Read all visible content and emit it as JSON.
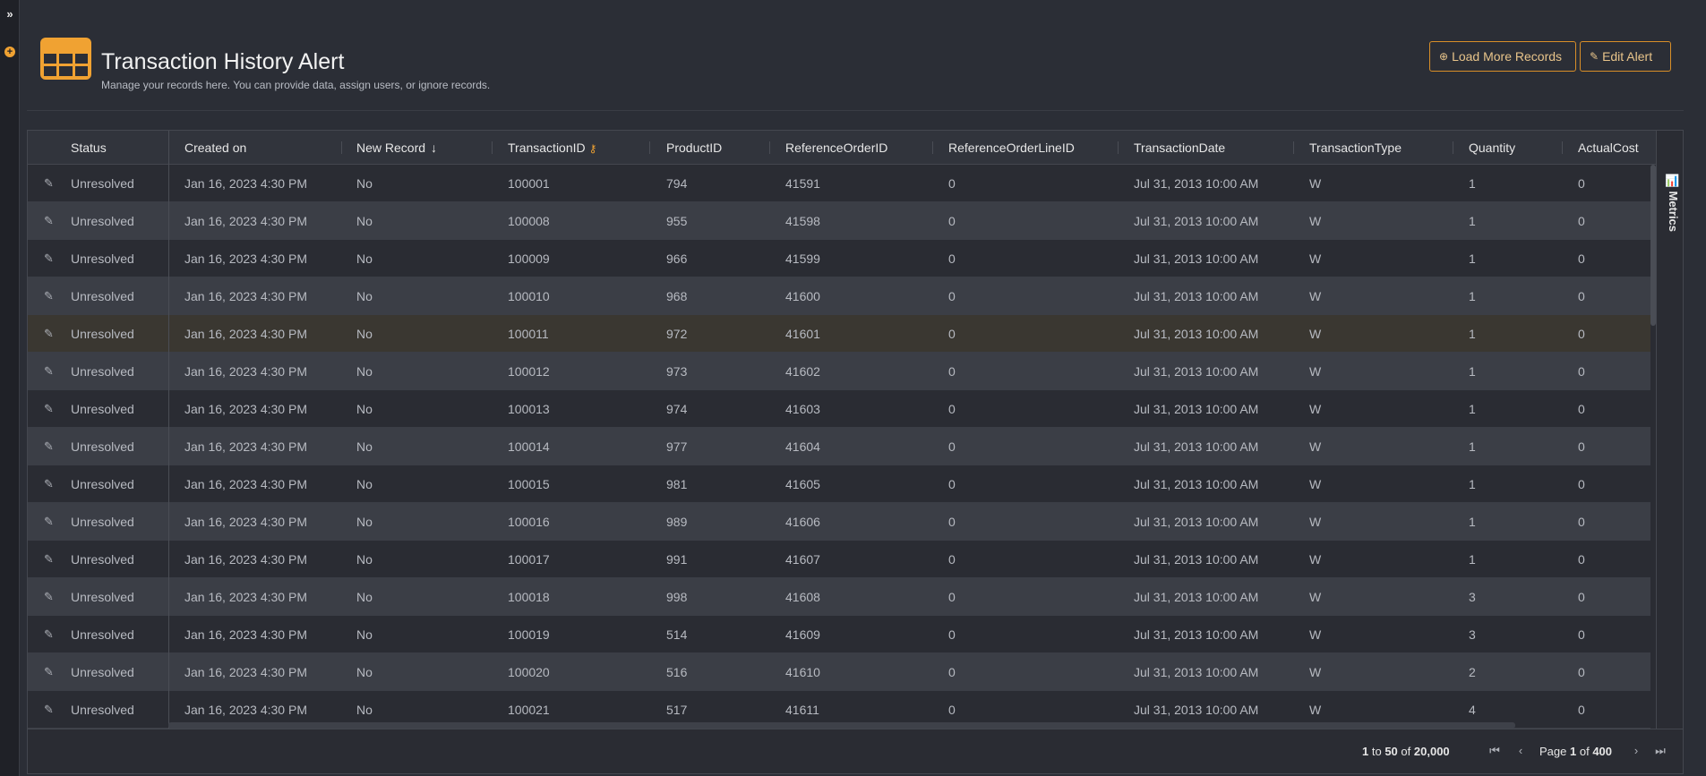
{
  "rail": {
    "expand_glyph": "»",
    "add_glyph": "+"
  },
  "header": {
    "title": "Transaction History Alert",
    "subtitle": "Manage your records here. You can provide data, assign users, or ignore records.",
    "icon": "table-grid-icon"
  },
  "actions": {
    "load_more_label": "Load More Records",
    "edit_alert_label": "Edit Alert",
    "load_more_icon": "plus-circle-icon",
    "edit_alert_icon": "edit-icon"
  },
  "columns": [
    "Status",
    "Created on",
    "New Record",
    "TransactionID",
    "ProductID",
    "ReferenceOrderID",
    "ReferenceOrderLineID",
    "TransactionDate",
    "TransactionType",
    "Quantity",
    "ActualCost"
  ],
  "rows": [
    [
      "Unresolved",
      "Jan 16, 2023 4:30 PM",
      "No",
      "100001",
      "794",
      "41591",
      "0",
      "Jul 31, 2013 10:00 AM",
      "W",
      "1",
      "0"
    ],
    [
      "Unresolved",
      "Jan 16, 2023 4:30 PM",
      "No",
      "100008",
      "955",
      "41598",
      "0",
      "Jul 31, 2013 10:00 AM",
      "W",
      "1",
      "0"
    ],
    [
      "Unresolved",
      "Jan 16, 2023 4:30 PM",
      "No",
      "100009",
      "966",
      "41599",
      "0",
      "Jul 31, 2013 10:00 AM",
      "W",
      "1",
      "0"
    ],
    [
      "Unresolved",
      "Jan 16, 2023 4:30 PM",
      "No",
      "100010",
      "968",
      "41600",
      "0",
      "Jul 31, 2013 10:00 AM",
      "W",
      "1",
      "0"
    ],
    [
      "Unresolved",
      "Jan 16, 2023 4:30 PM",
      "No",
      "100011",
      "972",
      "41601",
      "0",
      "Jul 31, 2013 10:00 AM",
      "W",
      "1",
      "0"
    ],
    [
      "Unresolved",
      "Jan 16, 2023 4:30 PM",
      "No",
      "100012",
      "973",
      "41602",
      "0",
      "Jul 31, 2013 10:00 AM",
      "W",
      "1",
      "0"
    ],
    [
      "Unresolved",
      "Jan 16, 2023 4:30 PM",
      "No",
      "100013",
      "974",
      "41603",
      "0",
      "Jul 31, 2013 10:00 AM",
      "W",
      "1",
      "0"
    ],
    [
      "Unresolved",
      "Jan 16, 2023 4:30 PM",
      "No",
      "100014",
      "977",
      "41604",
      "0",
      "Jul 31, 2013 10:00 AM",
      "W",
      "1",
      "0"
    ],
    [
      "Unresolved",
      "Jan 16, 2023 4:30 PM",
      "No",
      "100015",
      "981",
      "41605",
      "0",
      "Jul 31, 2013 10:00 AM",
      "W",
      "1",
      "0"
    ],
    [
      "Unresolved",
      "Jan 16, 2023 4:30 PM",
      "No",
      "100016",
      "989",
      "41606",
      "0",
      "Jul 31, 2013 10:00 AM",
      "W",
      "1",
      "0"
    ],
    [
      "Unresolved",
      "Jan 16, 2023 4:30 PM",
      "No",
      "100017",
      "991",
      "41607",
      "0",
      "Jul 31, 2013 10:00 AM",
      "W",
      "1",
      "0"
    ],
    [
      "Unresolved",
      "Jan 16, 2023 4:30 PM",
      "No",
      "100018",
      "998",
      "41608",
      "0",
      "Jul 31, 2013 10:00 AM",
      "W",
      "3",
      "0"
    ],
    [
      "Unresolved",
      "Jan 16, 2023 4:30 PM",
      "No",
      "100019",
      "514",
      "41609",
      "0",
      "Jul 31, 2013 10:00 AM",
      "W",
      "3",
      "0"
    ],
    [
      "Unresolved",
      "Jan 16, 2023 4:30 PM",
      "No",
      "100020",
      "516",
      "41610",
      "0",
      "Jul 31, 2013 10:00 AM",
      "W",
      "2",
      "0"
    ],
    [
      "Unresolved",
      "Jan 16, 2023 4:30 PM",
      "No",
      "100021",
      "517",
      "41611",
      "0",
      "Jul 31, 2013 10:00 AM",
      "W",
      "4",
      "0"
    ]
  ],
  "metrics_tab": {
    "label": "Metrics",
    "icon": "chart-icon"
  },
  "pagination": {
    "range_from": "1",
    "range_to_word": "to",
    "range_to": "50",
    "range_of_word": "of",
    "range_total": "20,000",
    "page_word": "Page",
    "page_current": "1",
    "page_of_word": "of",
    "page_total": "400"
  },
  "colors": {
    "accent": "#f0a232",
    "background": "#2b2e36",
    "row_alt": "#3b3e46"
  }
}
